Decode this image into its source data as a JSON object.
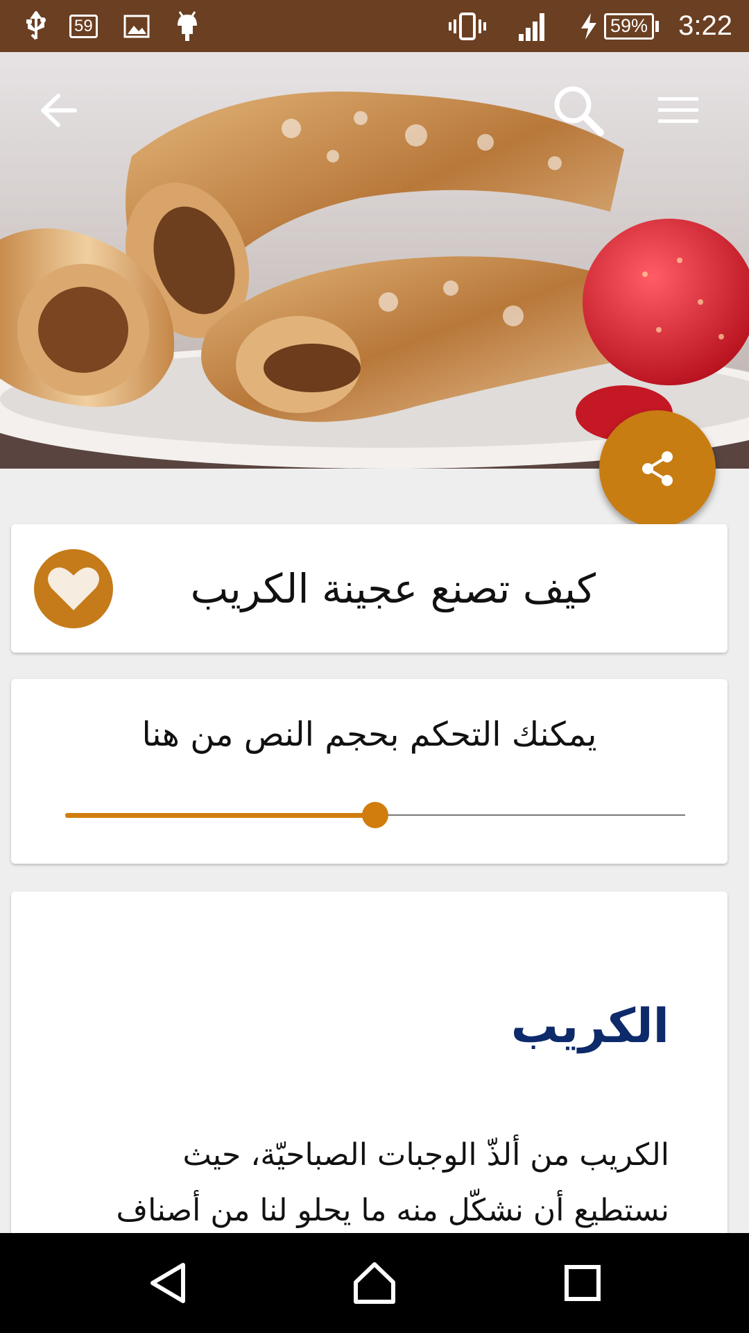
{
  "status_bar": {
    "time": "3:22",
    "battery": "59%",
    "notification_badge": "59",
    "icons": [
      "usb-icon",
      "notification-59-icon",
      "image-icon",
      "android-icon",
      "vibrate-icon",
      "signal-icon",
      "charging-icon",
      "battery-icon"
    ],
    "background_color": "#6b3f22"
  },
  "app_bar": {
    "icons": [
      "back-arrow-icon",
      "search-icon",
      "menu-icon"
    ]
  },
  "hero": {
    "image": "crepes-with-strawberries-photo"
  },
  "fab": {
    "icon": "share-icon",
    "color": "#c87d13"
  },
  "recipe": {
    "title": "كيف تصنع عجينة الكريب",
    "favorite_icon": "heart-icon"
  },
  "text_size": {
    "label": "يمكنك التحكم بحجم النص من هنا",
    "slider_value": 0.5,
    "accent_color": "#d07d0e"
  },
  "content": {
    "heading": "الكريب",
    "heading_color": "#0d2a6b",
    "body": "الكريب من ألذّ الوجبات الصباحيّة، حيث نستطيع أن نشكّل منه ما يحلو لنا من أصناف"
  },
  "nav_bar": {
    "icons": [
      "back-triangle-icon",
      "home-icon",
      "recents-icon"
    ]
  }
}
